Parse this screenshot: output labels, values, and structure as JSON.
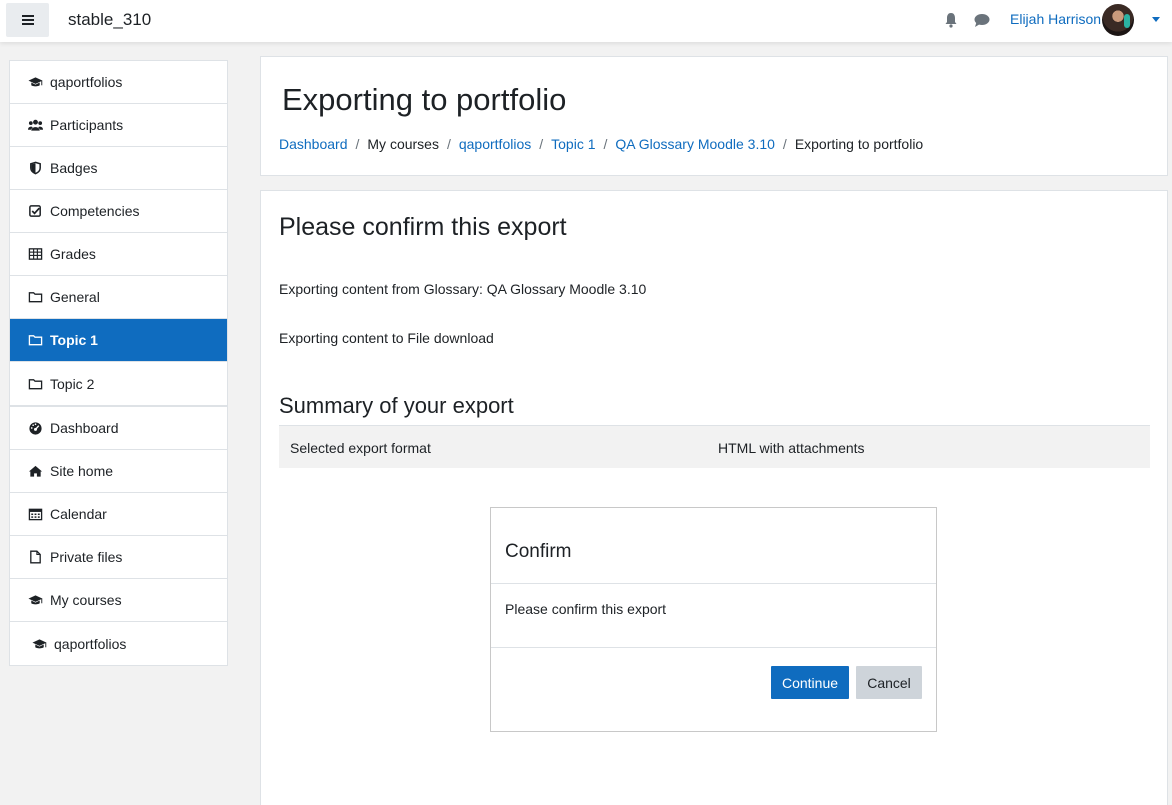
{
  "navbar": {
    "site_name": "stable_310",
    "user_name": "Elijah Harrison",
    "icons": {
      "menu": "hamburger-icon",
      "notifications": "bell-icon",
      "messages": "chat-icon",
      "user_menu": "caret-down-icon"
    }
  },
  "sidebar": {
    "course_nav": [
      {
        "label": "qaportfolios",
        "icon": "graduation-cap-icon"
      },
      {
        "label": "Participants",
        "icon": "users-icon"
      },
      {
        "label": "Badges",
        "icon": "shield-icon"
      },
      {
        "label": "Competencies",
        "icon": "check-square-icon"
      },
      {
        "label": "Grades",
        "icon": "table-icon"
      },
      {
        "label": "General",
        "icon": "folder-icon"
      },
      {
        "label": "Topic 1",
        "icon": "folder-icon",
        "active": true
      },
      {
        "label": "Topic 2",
        "icon": "folder-icon"
      }
    ],
    "site_nav": [
      {
        "label": "Dashboard",
        "icon": "dashboard-icon"
      },
      {
        "label": "Site home",
        "icon": "home-icon"
      },
      {
        "label": "Calendar",
        "icon": "calendar-icon"
      },
      {
        "label": "Private files",
        "icon": "file-icon"
      },
      {
        "label": "My courses",
        "icon": "graduation-cap-icon"
      },
      {
        "label": "qaportfolios",
        "icon": "graduation-cap-icon"
      }
    ]
  },
  "header": {
    "title": "Exporting to portfolio",
    "breadcrumb": [
      {
        "label": "Dashboard",
        "link": true
      },
      {
        "label": "My courses",
        "link": false
      },
      {
        "label": "qaportfolios",
        "link": true
      },
      {
        "label": "Topic 1",
        "link": true
      },
      {
        "label": "QA Glossary Moodle 3.10",
        "link": true
      },
      {
        "label": "Exporting to portfolio",
        "link": false
      }
    ],
    "separator": "/"
  },
  "main": {
    "heading": "Please confirm this export",
    "export_from": "Exporting content from Glossary: QA Glossary Moodle 3.10",
    "export_to": "Exporting content to File download",
    "summary_heading": "Summary of your export",
    "summary": {
      "label": "Selected export format",
      "value": "HTML with attachments"
    },
    "confirm": {
      "title": "Confirm",
      "message": "Please confirm this export",
      "continue_label": "Continue",
      "cancel_label": "Cancel"
    }
  },
  "colors": {
    "accent": "#0f6cbf",
    "sidebar_bg": "#f2f2f2",
    "cancel_bg": "#ced4da"
  }
}
